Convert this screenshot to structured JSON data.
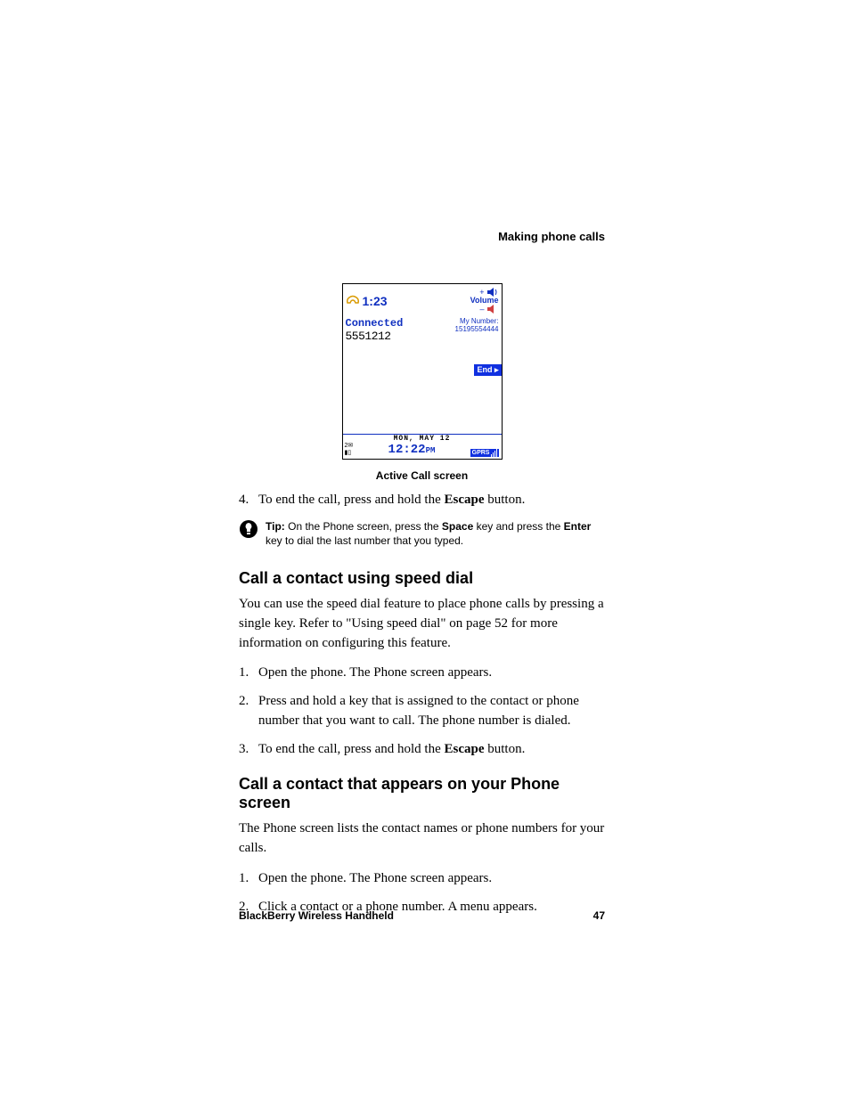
{
  "header": {
    "running_head": "Making phone calls"
  },
  "screenshot": {
    "call_timer": "1:23",
    "volume_label": "Volume",
    "volume_plus": "+",
    "volume_minus": "–",
    "status": "Connected",
    "dialed_number": "5551212",
    "my_number_label": "My Number:",
    "my_number_value": "15195554444",
    "end_button": "End ▸",
    "date_line": "mon, may 12",
    "clock_time": "12:22",
    "clock_ampm": "PM",
    "msg_count": "2",
    "network": "GPRS"
  },
  "caption": "Active Call screen",
  "step4": {
    "num": "4.",
    "pre": "To end the call, press and hold the ",
    "bold": "Escape",
    "post": " button."
  },
  "tip": {
    "lead": "Tip:",
    "t1": " On the Phone screen, press the ",
    "b1": "Space",
    "t2": " key and press the ",
    "b2": "Enter",
    "t3": " key to dial the last number that you typed."
  },
  "section_a": {
    "heading": "Call a contact using speed dial",
    "para": "You can use the speed dial feature to place phone calls by pressing a single key. Refer to \"Using speed dial\" on page 52 for more information on configuring this feature.",
    "steps": [
      {
        "num": "1.",
        "text": "Open the phone. The Phone screen appears."
      },
      {
        "num": "2.",
        "text": "Press and hold a key that is assigned to the contact or phone number that you want to call. The phone number is dialed."
      }
    ],
    "step3": {
      "num": "3.",
      "pre": "To end the call, press and hold the ",
      "bold": "Escape",
      "post": " button."
    }
  },
  "section_b": {
    "heading": "Call a contact that appears on your Phone screen",
    "para": "The Phone screen lists the contact names or phone numbers for your calls.",
    "steps": [
      {
        "num": "1.",
        "text": "Open the phone. The Phone screen appears."
      },
      {
        "num": "2.",
        "text": "Click a contact or a phone number. A menu appears."
      }
    ]
  },
  "footer": {
    "product": "BlackBerry Wireless Handheld",
    "page": "47"
  }
}
